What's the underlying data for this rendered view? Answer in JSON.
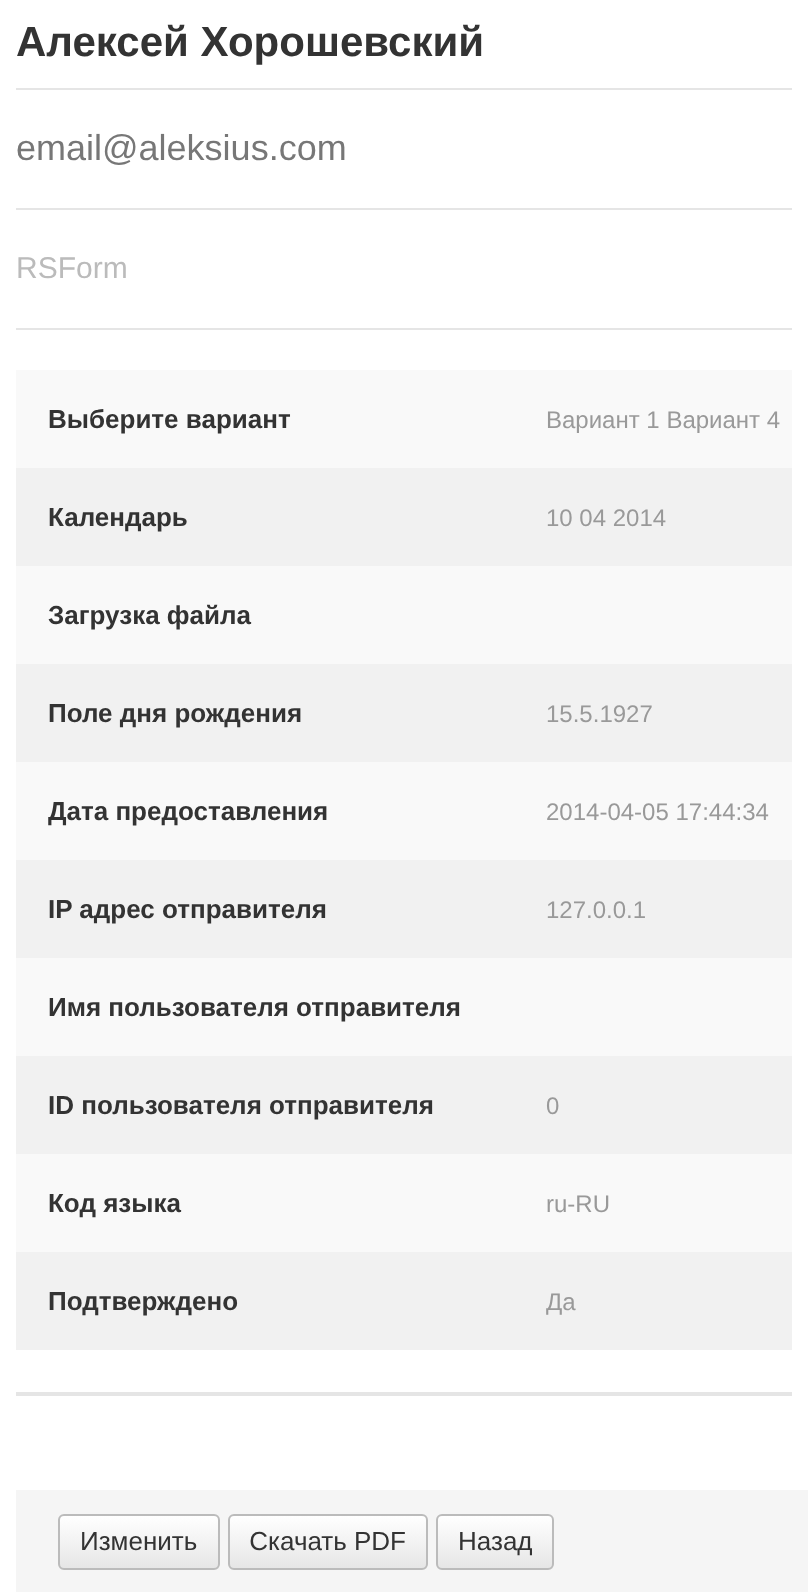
{
  "header": {
    "name": "Алексей Хорошевский",
    "email": "email@aleksius.com",
    "form": "RSForm"
  },
  "rows": [
    {
      "label": "Выберите вариант",
      "value": "Вариант 1 Вариант 4"
    },
    {
      "label": "Календарь",
      "value": "10 04 2014"
    },
    {
      "label": "Загрузка файла"
    },
    {
      "label": "Поле дня рождения",
      "value": "15.5.1927"
    },
    {
      "label": "Дата предоставления",
      "value": "2014-04-05 17:44:34"
    },
    {
      "label": "IP адрес отправителя",
      "value": "127.0.0.1"
    },
    {
      "label": "Имя пользователя отправителя"
    },
    {
      "label": "ID пользователя отправителя",
      "value": "0"
    },
    {
      "label": "Код языка",
      "value": "ru-RU"
    },
    {
      "label": "Подтверждено",
      "value": "Да"
    }
  ],
  "buttons": [
    "Изменить",
    "Скачать PDF",
    "Назад"
  ]
}
